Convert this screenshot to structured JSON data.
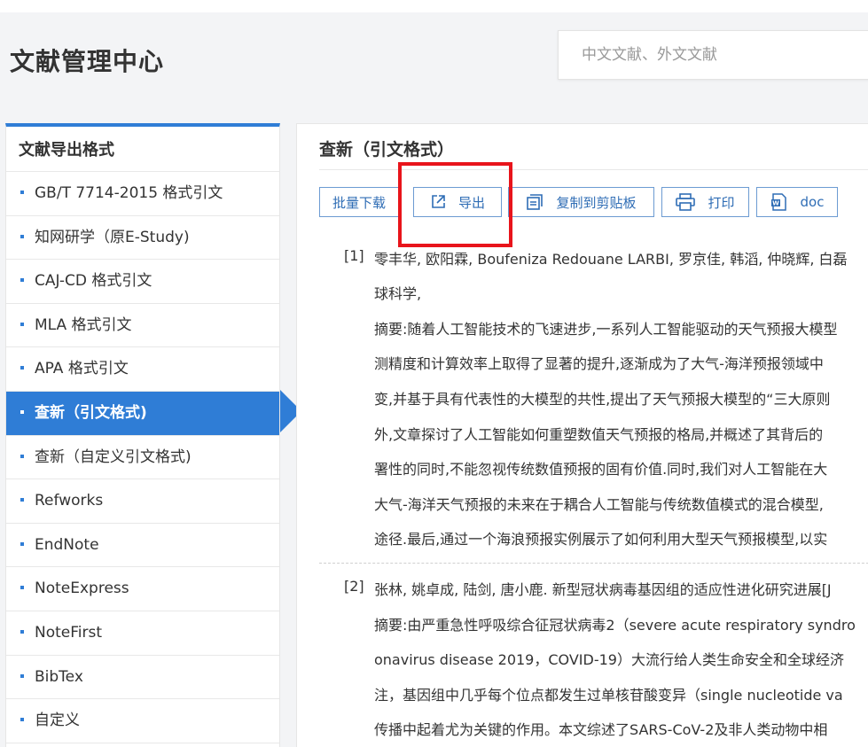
{
  "header": {
    "title": "文献管理中心",
    "search_placeholder": "中文文献、外文文献"
  },
  "sidebar": {
    "title": "文献导出格式",
    "items": [
      {
        "label": "GB/T 7714-2015 格式引文"
      },
      {
        "label": "知网研学（原E-Study)"
      },
      {
        "label": "CAJ-CD 格式引文"
      },
      {
        "label": "MLA 格式引文"
      },
      {
        "label": "APA 格式引文"
      },
      {
        "label": "查新（引文格式)"
      },
      {
        "label": "查新（自定义引文格式)"
      },
      {
        "label": "Refworks"
      },
      {
        "label": "EndNote"
      },
      {
        "label": "NoteExpress"
      },
      {
        "label": "NoteFirst"
      },
      {
        "label": "BibTex"
      },
      {
        "label": "自定义"
      }
    ],
    "active_index": 5
  },
  "main": {
    "title": "查新（引文格式）",
    "toolbar": {
      "batch_download": "批量下载",
      "export": "导出",
      "copy": "复制到剪贴板",
      "print": "打印",
      "doc": "doc"
    },
    "references": [
      {
        "num": "[1]",
        "lines": [
          "零丰华, 欧阳霖, Boufeniza Redouane LARBI, 罗京佳, 韩滔, 仲晓辉, 白磊",
          "球科学,",
          "摘要:随着人工智能技术的飞速进步,一系列人工智能驱动的天气预报大模型",
          "测精度和计算效率上取得了显著的提升,逐渐成为了大气-海洋预报领域中",
          "变,并基于具有代表性的大模型的共性,提出了天气预报大模型的“三大原则",
          "外,文章探讨了人工智能如何重塑数值天气预报的格局,并概述了其背后的",
          "署性的同时,不能忽视传统数值预报的固有价值.同时,我们对人工智能在大",
          "大气-海洋天气预报的未来在于耦合人工智能与传统数值模式的混合模型,",
          "途径.最后,通过一个海浪预报实例展示了如何利用大型天气预报模型,以实"
        ]
      },
      {
        "num": "[2]",
        "lines": [
          "张林, 姚卓成, 陆剑, 唐小鹿. 新型冠状病毒基因组的适应性进化研究进展[J",
          "摘要:由严重急性呼吸综合征冠状病毒2（severe acute respiratory syndro",
          "onavirus disease 2019，COVID-19）大流行给人类生命安全和全球经济",
          "注，基因组中几乎每个位点都发生过单核苷酸变异（single nucleotide va",
          "传播中起着尤为关键的作用。本文综述了SARS-CoV-2及非人类动物中相"
        ]
      }
    ]
  },
  "colors": {
    "accent": "#2f7dd6",
    "highlight": "#e8141b"
  }
}
